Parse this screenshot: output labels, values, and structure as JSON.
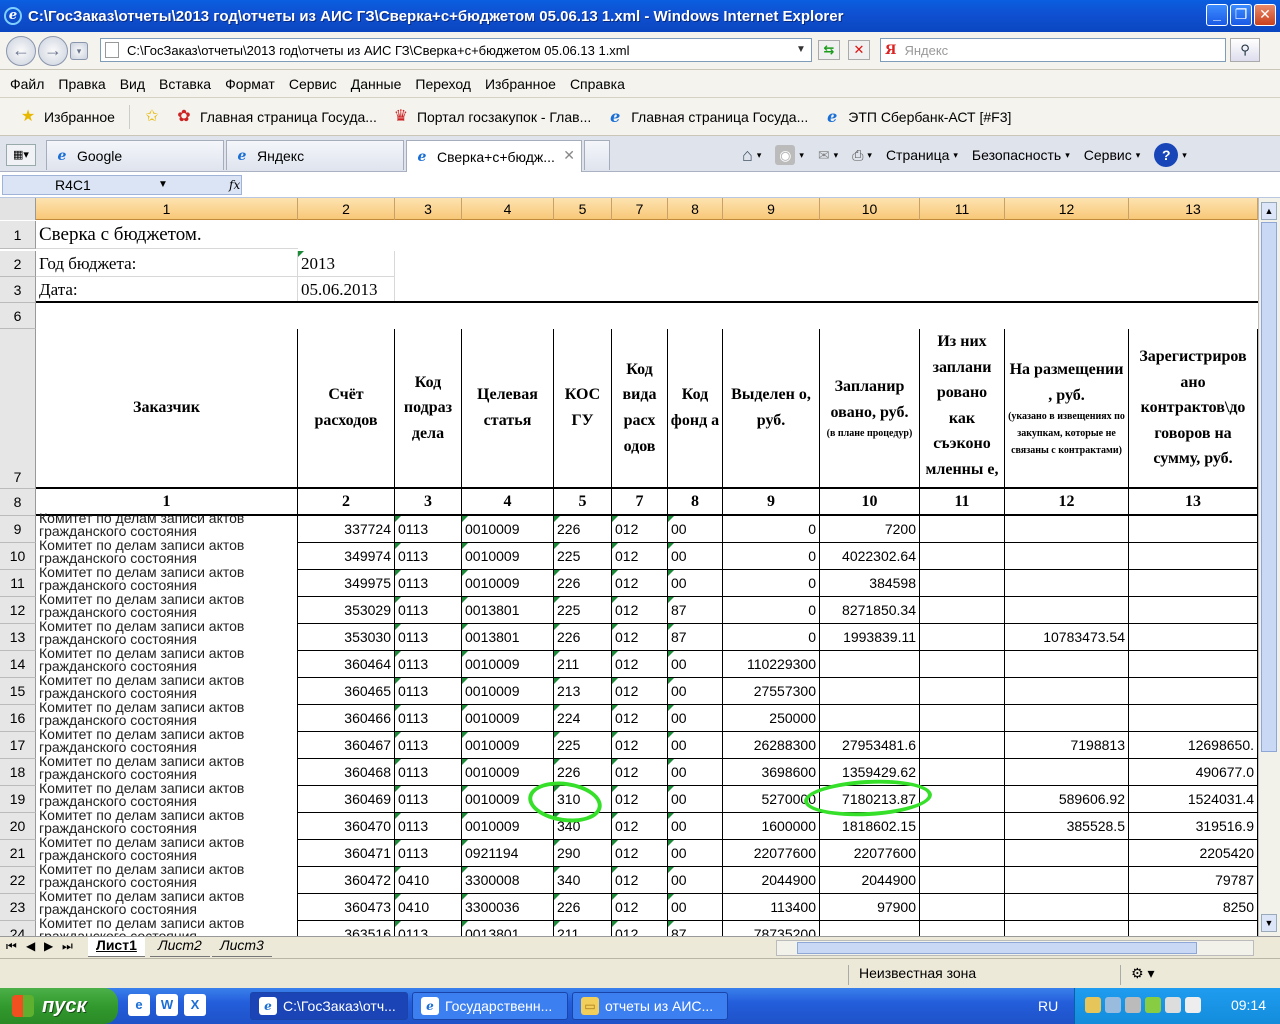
{
  "window": {
    "title": "C:\\ГосЗаказ\\отчеты\\2013 год\\отчеты из АИС ГЗ\\Сверка+с+бюджетом 05.06.13 1.xml - Windows Internet Explorer"
  },
  "address": {
    "url": "C:\\ГосЗаказ\\отчеты\\2013 год\\отчеты из АИС ГЗ\\Сверка+с+бюджетом 05.06.13 1.xml",
    "search_placeholder": "Яндекс"
  },
  "menu": [
    "Файл",
    "Правка",
    "Вид",
    "Вставка",
    "Формат",
    "Сервис",
    "Данные",
    "Переход",
    "Избранное",
    "Справка"
  ],
  "favorites": {
    "label": "Избранное",
    "items": [
      "Главная страница  Госуда...",
      "Портал госзакупок - Глав...",
      "Главная страница  Госуда...",
      "ЭТП Сбербанк-АСТ [#F3]"
    ]
  },
  "tabs": [
    "Google",
    "Яндекс",
    "Сверка+с+бюдж..."
  ],
  "tab_tools": [
    "Страница",
    "Безопасность",
    "Сервис"
  ],
  "formula": {
    "name_box": "R4C1",
    "fx": "fx"
  },
  "columns": [
    "1",
    "2",
    "3",
    "4",
    "5",
    "7",
    "8",
    "9",
    "10",
    "11",
    "12",
    "13"
  ],
  "header_rows": {
    "r1": {
      "num": "1",
      "text": "Сверка с бюджетом."
    },
    "r2": {
      "num": "2",
      "label": "Год бюджета:",
      "value": "2013"
    },
    "r3": {
      "num": "3",
      "label": "Дата:",
      "value": "05.06.2013"
    },
    "r6": {
      "num": "6"
    },
    "r7": {
      "num": "7"
    },
    "r8": {
      "num": "8"
    }
  },
  "table_header": [
    "Заказчик",
    "Счёт расходов",
    "Код подраз дела",
    "Целевая статья",
    "КОС ГУ",
    "Код вида расх одов",
    "Код фонд а",
    "Выделен о, руб.",
    "Запланир овано, руб.",
    "Из них заплани ровано как съэконо мленны е, руб.",
    "На размещении , руб.",
    "Зарегистриров ано контрактов\\до говоров на сумму, руб."
  ],
  "table_header_notes": {
    "planned": "(в плане процедур)",
    "placement": "(указано в извещениях по закупкам, которые не связаны с контрактами)"
  },
  "column_numbers": [
    "1",
    "2",
    "3",
    "4",
    "5",
    "7",
    "8",
    "9",
    "10",
    "11",
    "12",
    "13"
  ],
  "rows": [
    {
      "n": "9",
      "cust": "Комитет по делам записи актов гражданского состояния",
      "acc": "337724",
      "div": "0113",
      "art": "0010009",
      "kosgu": "226",
      "vid": "012",
      "fund": "00",
      "alloc": "0",
      "plan": "7200",
      "econ": "",
      "place": "",
      "reg": ""
    },
    {
      "n": "10",
      "cust": "Комитет по делам записи актов гражданского состояния",
      "acc": "349974",
      "div": "0113",
      "art": "0010009",
      "kosgu": "225",
      "vid": "012",
      "fund": "00",
      "alloc": "0",
      "plan": "4022302.64",
      "econ": "",
      "place": "",
      "reg": ""
    },
    {
      "n": "11",
      "cust": "Комитет по делам записи актов гражданского состояния",
      "acc": "349975",
      "div": "0113",
      "art": "0010009",
      "kosgu": "226",
      "vid": "012",
      "fund": "00",
      "alloc": "0",
      "plan": "384598",
      "econ": "",
      "place": "",
      "reg": ""
    },
    {
      "n": "12",
      "cust": "Комитет по делам записи актов гражданского состояния",
      "acc": "353029",
      "div": "0113",
      "art": "0013801",
      "kosgu": "225",
      "vid": "012",
      "fund": "87",
      "alloc": "0",
      "plan": "8271850.34",
      "econ": "",
      "place": "",
      "reg": ""
    },
    {
      "n": "13",
      "cust": "Комитет по делам записи актов гражданского состояния",
      "acc": "353030",
      "div": "0113",
      "art": "0013801",
      "kosgu": "226",
      "vid": "012",
      "fund": "87",
      "alloc": "0",
      "plan": "1993839.11",
      "econ": "",
      "place": "10783473.54",
      "reg": ""
    },
    {
      "n": "14",
      "cust": "Комитет по делам записи актов гражданского состояния",
      "acc": "360464",
      "div": "0113",
      "art": "0010009",
      "kosgu": "211",
      "vid": "012",
      "fund": "00",
      "alloc": "110229300",
      "plan": "",
      "econ": "",
      "place": "",
      "reg": ""
    },
    {
      "n": "15",
      "cust": "Комитет по делам записи актов гражданского состояния",
      "acc": "360465",
      "div": "0113",
      "art": "0010009",
      "kosgu": "213",
      "vid": "012",
      "fund": "00",
      "alloc": "27557300",
      "plan": "",
      "econ": "",
      "place": "",
      "reg": ""
    },
    {
      "n": "16",
      "cust": "Комитет по делам записи актов гражданского состояния",
      "acc": "360466",
      "div": "0113",
      "art": "0010009",
      "kosgu": "224",
      "vid": "012",
      "fund": "00",
      "alloc": "250000",
      "plan": "",
      "econ": "",
      "place": "",
      "reg": ""
    },
    {
      "n": "17",
      "cust": "Комитет по делам записи актов гражданского состояния",
      "acc": "360467",
      "div": "0113",
      "art": "0010009",
      "kosgu": "225",
      "vid": "012",
      "fund": "00",
      "alloc": "26288300",
      "plan": "27953481.6",
      "econ": "",
      "place": "7198813",
      "reg": "12698650."
    },
    {
      "n": "18",
      "cust": "Комитет по делам записи актов гражданского состояния",
      "acc": "360468",
      "div": "0113",
      "art": "0010009",
      "kosgu": "226",
      "vid": "012",
      "fund": "00",
      "alloc": "3698600",
      "plan": "1359429.62",
      "econ": "",
      "place": "",
      "reg": "490677.0"
    },
    {
      "n": "19",
      "cust": "Комитет по делам записи актов гражданского состояния",
      "acc": "360469",
      "div": "0113",
      "art": "0010009",
      "kosgu": "310",
      "vid": "012",
      "fund": "00",
      "alloc": "5270000",
      "plan": "7180213.87",
      "econ": "",
      "place": "589606.92",
      "reg": "1524031.4"
    },
    {
      "n": "20",
      "cust": "Комитет по делам записи актов гражданского состояния",
      "acc": "360470",
      "div": "0113",
      "art": "0010009",
      "kosgu": "340",
      "vid": "012",
      "fund": "00",
      "alloc": "1600000",
      "plan": "1818602.15",
      "econ": "",
      "place": "385528.5",
      "reg": "319516.9"
    },
    {
      "n": "21",
      "cust": "Комитет по делам записи актов гражданского состояния",
      "acc": "360471",
      "div": "0113",
      "art": "0921194",
      "kosgu": "290",
      "vid": "012",
      "fund": "00",
      "alloc": "22077600",
      "plan": "22077600",
      "econ": "",
      "place": "",
      "reg": "2205420"
    },
    {
      "n": "22",
      "cust": "Комитет по делам записи актов гражданского состояния",
      "acc": "360472",
      "div": "0410",
      "art": "3300008",
      "kosgu": "340",
      "vid": "012",
      "fund": "00",
      "alloc": "2044900",
      "plan": "2044900",
      "econ": "",
      "place": "",
      "reg": "79787"
    },
    {
      "n": "23",
      "cust": "Комитет по делам записи актов гражданского состояния",
      "acc": "360473",
      "div": "0410",
      "art": "3300036",
      "kosgu": "226",
      "vid": "012",
      "fund": "00",
      "alloc": "113400",
      "plan": "97900",
      "econ": "",
      "place": "",
      "reg": "8250"
    },
    {
      "n": "24",
      "cust": "Комитет по делам записи актов гражданского состояния",
      "acc": "363516",
      "div": "0113",
      "art": "0013801",
      "kosgu": "211",
      "vid": "012",
      "fund": "87",
      "alloc": "78735200",
      "plan": "",
      "econ": "",
      "place": "",
      "reg": ""
    }
  ],
  "sheets": [
    "Лист1",
    "Лист2",
    "Лист3"
  ],
  "status": {
    "zone": "Неизвестная зона"
  },
  "taskbar": {
    "start": "пуск",
    "tasks": [
      "C:\\ГосЗаказ\\отч...",
      "Государственн...",
      "отчеты из АИС..."
    ],
    "lang": "RU",
    "clock": "09:14"
  }
}
